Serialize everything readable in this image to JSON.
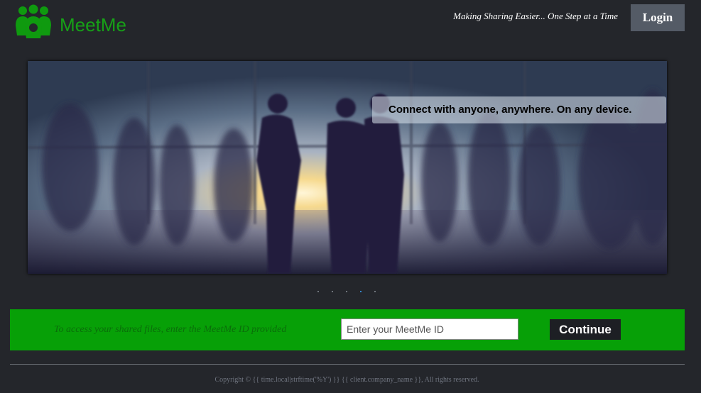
{
  "header": {
    "brand": "MeetMe",
    "logo_icon": "people-group-icon",
    "tagline": "Making Sharing Easier... One Step at a Time",
    "login_label": "Login"
  },
  "hero": {
    "caption": "Connect with anyone, anywhere. On any device.",
    "carousel": {
      "slide_count": 5,
      "active_index": 3
    }
  },
  "access": {
    "instructions": "To access your shared files, enter the MeetMe ID provided",
    "input_placeholder": "Enter your MeetMe ID",
    "input_value": "",
    "continue_label": "Continue"
  },
  "footer": {
    "copyright": "Copyright © {{ time.local|strftime('%Y') }} {{ client.company_name }}, All rights reserved."
  },
  "colors": {
    "page_bg": "#24262b",
    "brand_green": "#17a017",
    "access_bar_green": "#07a007",
    "login_bg": "#545b66"
  }
}
